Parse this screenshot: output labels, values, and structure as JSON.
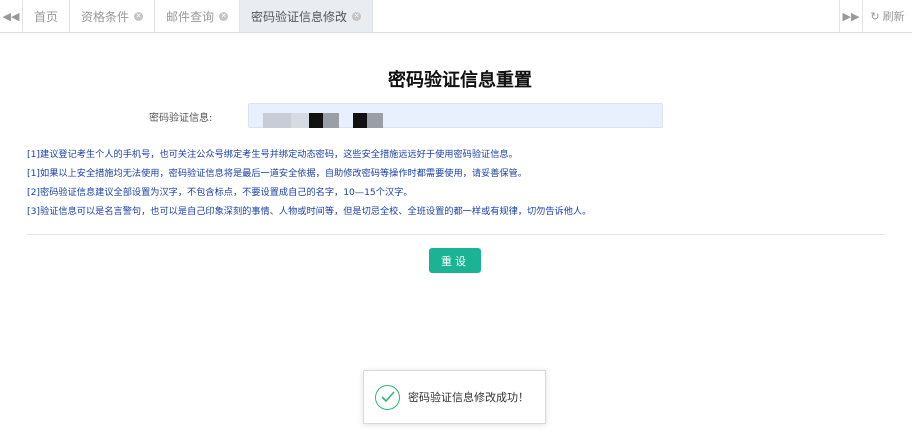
{
  "tabbar": {
    "tabs": [
      {
        "label": "首页",
        "closable": false,
        "active": false
      },
      {
        "label": "资格条件",
        "closable": true,
        "active": false
      },
      {
        "label": "邮件查询",
        "closable": true,
        "active": false
      },
      {
        "label": "密码验证信息修改",
        "closable": true,
        "active": true
      }
    ],
    "refresh_label": "刷新"
  },
  "page": {
    "title": "密码验证信息重置",
    "field_label": "密码验证信息:",
    "notes": [
      "[1]建议登记考生个人的手机号，也可关注公众号绑定考生号并绑定动态密码，这些安全措施远远好于使用密码验证信息。",
      "[1]如果以上安全措施均无法使用，密码验证信息将是最后一道安全依据，自助修改密码等操作时都需要使用，请妥善保管。",
      "[2]密码验证信息建议全部设置为汉字，不包含标点，不要设置成自己的名字，10—15个汉字。",
      "[3]验证信息可以是名言警句，也可以是自己印象深刻的事情、人物或时间等，但是切忌全校、全班设置的都一样或有规律，切勿告诉他人。"
    ],
    "reset_label": "重设"
  },
  "toast": {
    "message": "密码验证信息修改成功！"
  },
  "colors": {
    "accent": "#1ab394",
    "note_text": "#1a3fa8",
    "success": "#2eb872"
  }
}
